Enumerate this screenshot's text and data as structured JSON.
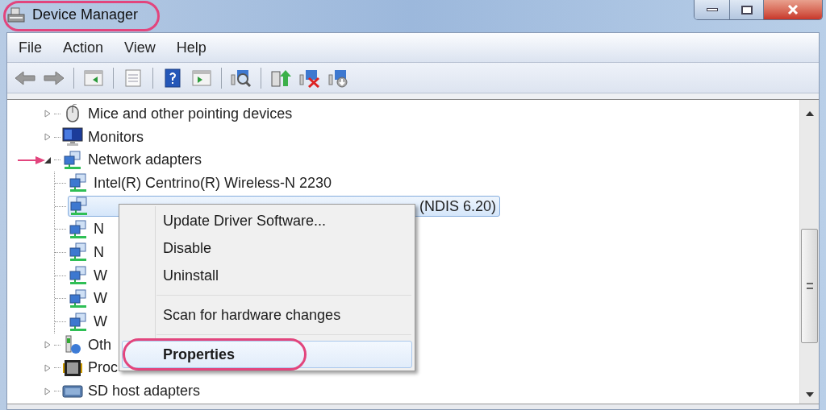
{
  "window": {
    "title": "Device Manager",
    "circled": true
  },
  "menu_bar": [
    "File",
    "Action",
    "View",
    "Help"
  ],
  "tree": [
    {
      "kind": "mouse",
      "label": "Mice and other pointing devices",
      "expanded": false,
      "arrow_marked": false
    },
    {
      "kind": "monitor",
      "label": "Monitors",
      "expanded": false,
      "arrow_marked": false
    },
    {
      "kind": "network",
      "label": "Network adapters",
      "expanded": true,
      "arrow_marked": true,
      "children": [
        {
          "kind": "network",
          "label": "Intel(R) Centrino(R) Wireless-N 2230",
          "selected": false
        },
        {
          "kind": "network",
          "label": "(NDIS 6.20)",
          "selected": true
        },
        {
          "kind": "network",
          "label": "N",
          "selected": false
        },
        {
          "kind": "network",
          "label": "N",
          "selected": false
        },
        {
          "kind": "network",
          "label": "W",
          "selected": false
        },
        {
          "kind": "network",
          "label": "W",
          "selected": false
        },
        {
          "kind": "network",
          "label": "W",
          "selected": false
        }
      ]
    },
    {
      "kind": "other",
      "label": "Oth",
      "expanded": false,
      "arrow_marked": false
    },
    {
      "kind": "processor",
      "label": "Proc",
      "expanded": false,
      "arrow_marked": false
    },
    {
      "kind": "sd",
      "label": "SD host adapters",
      "expanded": false,
      "arrow_marked": false
    }
  ],
  "context_menu": {
    "items": [
      {
        "kind": "item",
        "label": "Update Driver Software...",
        "selected": false,
        "default": false,
        "circled": false
      },
      {
        "kind": "item",
        "label": "Disable",
        "selected": false,
        "default": false,
        "circled": false
      },
      {
        "kind": "item",
        "label": "Uninstall",
        "selected": false,
        "default": false,
        "circled": false
      },
      {
        "kind": "separator"
      },
      {
        "kind": "item",
        "label": "Scan for hardware changes",
        "selected": false,
        "default": false,
        "circled": false
      },
      {
        "kind": "separator"
      },
      {
        "kind": "item",
        "label": "Properties",
        "selected": true,
        "default": true,
        "circled": true
      }
    ]
  }
}
